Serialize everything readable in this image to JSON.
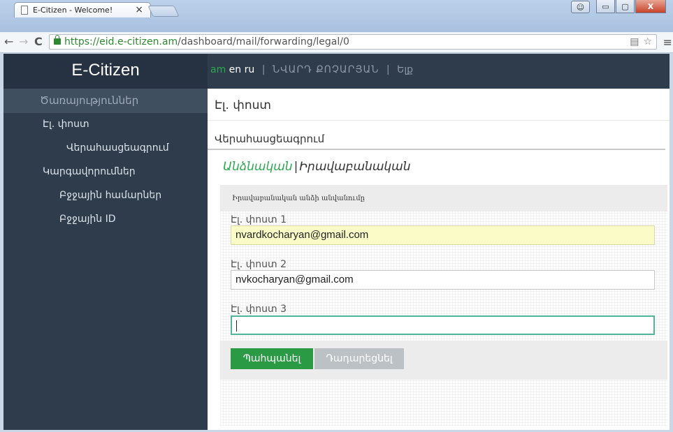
{
  "browser": {
    "tab_title": "E-Citizen - Welcome!",
    "tab_close": "×",
    "url_host": "https://eid.e-citizen.am",
    "url_path": "/dashboard/mail/forwarding/legal/0",
    "window_buttons": {
      "minimize": "▭",
      "maximize": "▢",
      "close": "X"
    },
    "nav": {
      "back": "←",
      "forward": "→",
      "reload": "C"
    },
    "url_icons": {
      "translate": "▤",
      "star": "☆"
    },
    "menu": "≡"
  },
  "sidebar": {
    "brand": "E-Citizen",
    "services_header": "Ծառայություններ",
    "items": [
      {
        "label": "Էլ. փոստ"
      },
      {
        "label": "Վերահասցեագրում"
      },
      {
        "label": "Կարգավորումներ"
      },
      {
        "label": "Բջջային համարներ"
      },
      {
        "label": "Բջջային ID"
      }
    ]
  },
  "topbar": {
    "lang_am": "am",
    "lang_en": "en",
    "lang_ru": "ru",
    "separator": "|",
    "user_name": "ՆՎԱՐԴ ՔՈՉԱՐՅԱՆ",
    "exit": "Ելք"
  },
  "content": {
    "title": "Էլ. փոստ",
    "subtitle": "Վերահասցեագրում",
    "tab_personal": "Անձնական",
    "tab_separator": "|",
    "tab_legal": "Իրավաբանական",
    "panel_heading": "Իրավաբանական անձի անվանումը",
    "fields": [
      {
        "label": "Էլ. փոստ 1",
        "value": "nvardkocharyan@gmail.com"
      },
      {
        "label": "Էլ. փոստ 2",
        "value": "nvkocharyan@gmail.com"
      },
      {
        "label": "Էլ. փոստ 3",
        "value": ""
      }
    ],
    "save_button": "Պահպանել",
    "clear_button": "Դադարեցնել"
  }
}
